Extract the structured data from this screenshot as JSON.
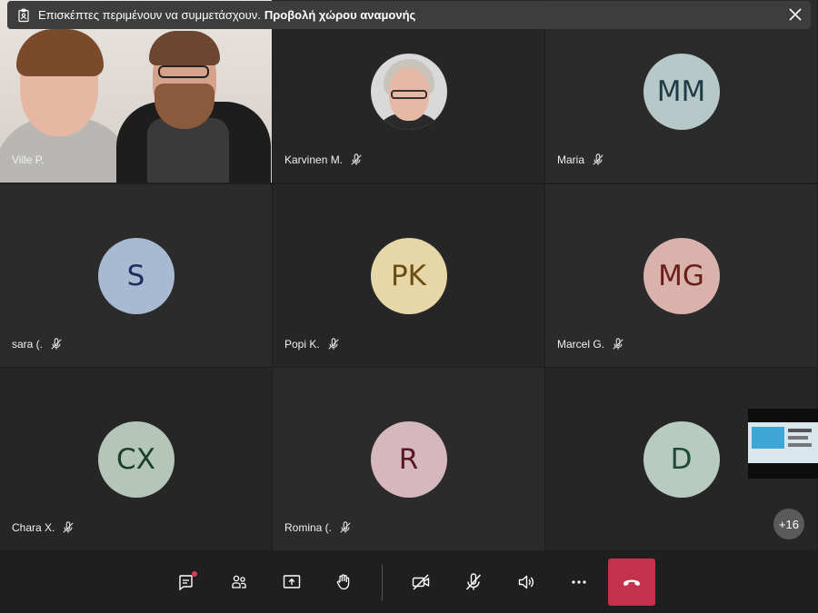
{
  "banner": {
    "text": "Επισκέπτες περιμένουν να συμμετάσχουν.",
    "link": "Προβολή χώρου αναμονής"
  },
  "participants": [
    {
      "name": "Ville P.",
      "type": "video"
    },
    {
      "name": "Karvinen M.",
      "type": "photo"
    },
    {
      "name": "Maria",
      "initials": "MM",
      "bg": "#b6c8c8",
      "fg": "#1e3a47"
    },
    {
      "name": "sara (.",
      "initials": "S",
      "bg": "#a8b9d2",
      "fg": "#1b2e5c"
    },
    {
      "name": "Popi K.",
      "initials": "PK",
      "bg": "#e6d6a8",
      "fg": "#6a4d12"
    },
    {
      "name": "Marcel G.",
      "initials": "MG",
      "bg": "#d9b2ab",
      "fg": "#6b1e18"
    },
    {
      "name": "Chara X.",
      "initials": "CX",
      "bg": "#b3c6b9",
      "fg": "#1d3d2b"
    },
    {
      "name": "Romina (.",
      "initials": "R",
      "bg": "#d6b7bd",
      "fg": "#5a1827"
    },
    {
      "name": "",
      "initials": "D",
      "bg": "#b8cbc0",
      "fg": "#1d4a33"
    }
  ],
  "overflow": {
    "label": "+16"
  },
  "colors": {
    "hangup": "#c4314b",
    "notification_dot": "#e83a4d"
  },
  "toolbar": {
    "icons": [
      "chat-icon",
      "people-icon",
      "share-screen-icon",
      "raise-hand-icon",
      "camera-off-icon",
      "mic-off-icon",
      "speaker-icon",
      "more-icon",
      "hang-up-icon"
    ]
  }
}
